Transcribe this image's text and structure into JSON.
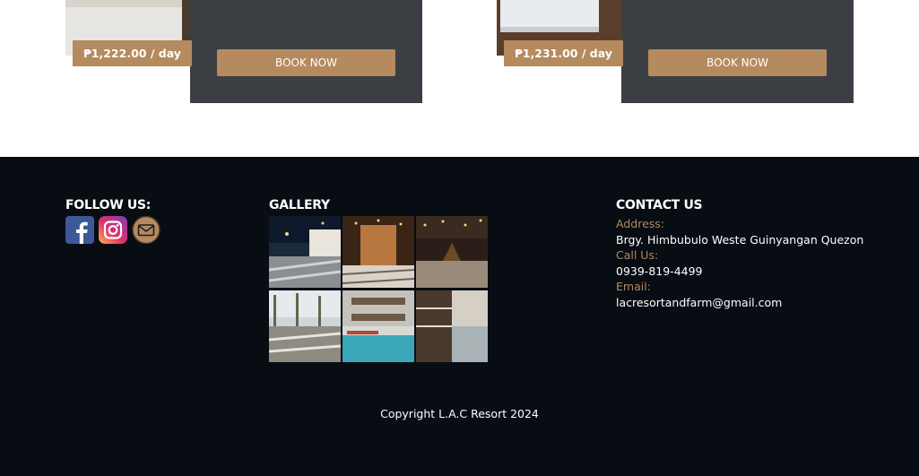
{
  "rooms": [
    {
      "price": "₱1,222.00 / day",
      "book_label": "BOOK NOW"
    },
    {
      "price": "₱1,231.00 / day",
      "book_label": "BOOK NOW"
    }
  ],
  "footer": {
    "follow_title": "FOLLOW US:",
    "social_icons": [
      "facebook-icon",
      "instagram-icon",
      "email-icon"
    ],
    "gallery_title": "GALLERY",
    "contact_title": "CONTACT US",
    "address_label": "Address:",
    "address_value": "Brgy. Himbubulo Weste Guinyangan Quezon",
    "call_label": "Call Us:",
    "call_value": "0939-819-4499",
    "email_label": "Email:",
    "email_value": "lacresortandfarm@gmail.com",
    "copyright": "Copyright L.A.C Resort 2024"
  },
  "colors": {
    "accent": "#b48a5e",
    "footer_bg": "#080c13",
    "panel": "#3b3f44"
  }
}
